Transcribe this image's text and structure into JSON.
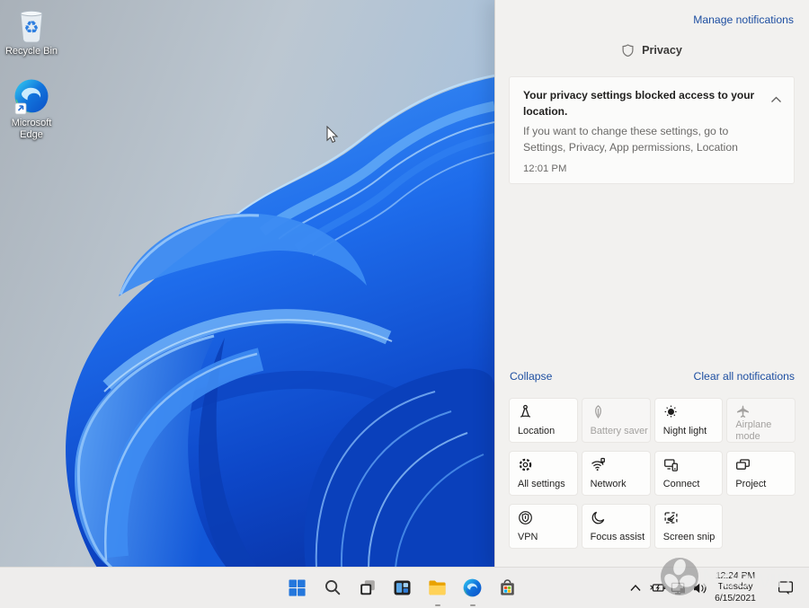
{
  "desktop": {
    "icons": [
      {
        "label": "Recycle Bin",
        "icon": "recycle-bin-icon"
      },
      {
        "label": "Microsoft Edge",
        "icon": "edge-icon"
      }
    ]
  },
  "action_center": {
    "manage_link": "Manage notifications",
    "group_title": "Privacy",
    "group_icon": "privacy-shield-icon",
    "notification": {
      "title": "Your privacy settings blocked access to your location.",
      "body": "If you want to change these settings, go to Settings, Privacy, App permissions, Location",
      "time": "12:01 PM"
    },
    "collapse_label": "Collapse",
    "clear_label": "Clear all notifications",
    "quick_actions": [
      {
        "label": "Location",
        "icon": "location-icon",
        "disabled": false
      },
      {
        "label": "Battery saver",
        "icon": "battery-saver-leaf-icon",
        "disabled": true
      },
      {
        "label": "Night light",
        "icon": "night-light-sun-icon",
        "disabled": false
      },
      {
        "label": "Airplane mode",
        "icon": "airplane-icon",
        "disabled": true
      },
      {
        "label": "All settings",
        "icon": "settings-gear-icon",
        "disabled": false
      },
      {
        "label": "Network",
        "icon": "network-wifi-icon",
        "disabled": false
      },
      {
        "label": "Connect",
        "icon": "connect-devices-icon",
        "disabled": false
      },
      {
        "label": "Project",
        "icon": "project-screens-icon",
        "disabled": false
      },
      {
        "label": "VPN",
        "icon": "vpn-shield-icon",
        "disabled": false
      },
      {
        "label": "Focus assist",
        "icon": "focus-assist-moon-icon",
        "disabled": false
      },
      {
        "label": "Screen snip",
        "icon": "screen-snip-icon",
        "disabled": false
      }
    ]
  },
  "taskbar": {
    "buttons": [
      {
        "icon": "start-icon",
        "running": false
      },
      {
        "icon": "search-icon",
        "running": false
      },
      {
        "icon": "task-view-icon",
        "running": false
      },
      {
        "icon": "widgets-icon",
        "running": false
      },
      {
        "icon": "file-explorer-icon",
        "running": true
      },
      {
        "icon": "edge-browser-icon",
        "running": true
      },
      {
        "icon": "microsoft-store-icon",
        "running": false
      }
    ],
    "tray": {
      "icons": [
        "chevron-up-icon",
        "battery-charging-icon",
        "ethernet-icon",
        "volume-icon",
        "notifications-bubble-icon"
      ],
      "clock": {
        "time": "12:24 PM",
        "day": "Tuesday",
        "date": "6/15/2021"
      }
    }
  },
  "watermark": {
    "text": "Neowin"
  },
  "colors": {
    "link_blue": "#1e4fa1",
    "panel_bg": "#f2f1ef",
    "card_bg": "#fbfbfa",
    "taskbar_bg": "#eeedec",
    "bloom_blue": "#1565e6"
  }
}
